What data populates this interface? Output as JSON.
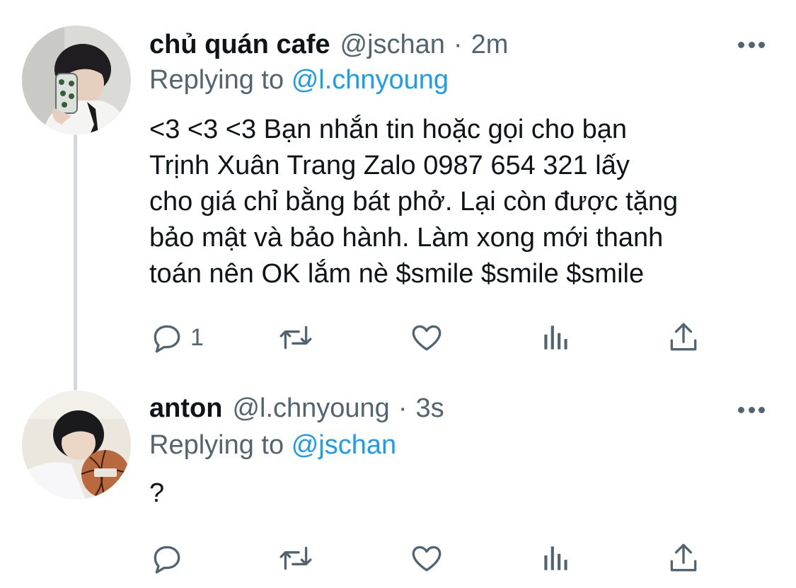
{
  "colors": {
    "text_primary": "#0f1419",
    "text_secondary": "#536471",
    "mention": "#1d9bf0",
    "thread_line": "#cfd9de"
  },
  "tweets": [
    {
      "display_name": "chủ quán cafe",
      "handle": "@jschan",
      "separator": "·",
      "time": "2m",
      "replying_prefix": "Replying to",
      "replying_to": "@l.chnyoung",
      "text_lines": [
        "<3 <3 <3 Bạn nhắn tin hoặc gọi cho bạn",
        "Trịnh Xuân Trang Zalo 0987 654 321 lấy",
        "cho giá chỉ bằng bát phở. Lại còn được tặng",
        "bảo mật và bảo hành. Làm xong mới thanh",
        "toán nên OK lắm nè $smile $smile $smile"
      ],
      "reply_count": "1",
      "icons": [
        "reply-icon",
        "retweet-icon",
        "like-icon",
        "views-icon",
        "share-icon",
        "more-icon"
      ]
    },
    {
      "display_name": "anton",
      "handle": "@l.chnyoung",
      "separator": "·",
      "time": "3s",
      "replying_prefix": "Replying to",
      "replying_to": "@jschan",
      "text_lines": [
        "?"
      ],
      "reply_count": "",
      "icons": [
        "reply-icon",
        "retweet-icon",
        "like-icon",
        "views-icon",
        "share-icon",
        "more-icon"
      ]
    }
  ]
}
